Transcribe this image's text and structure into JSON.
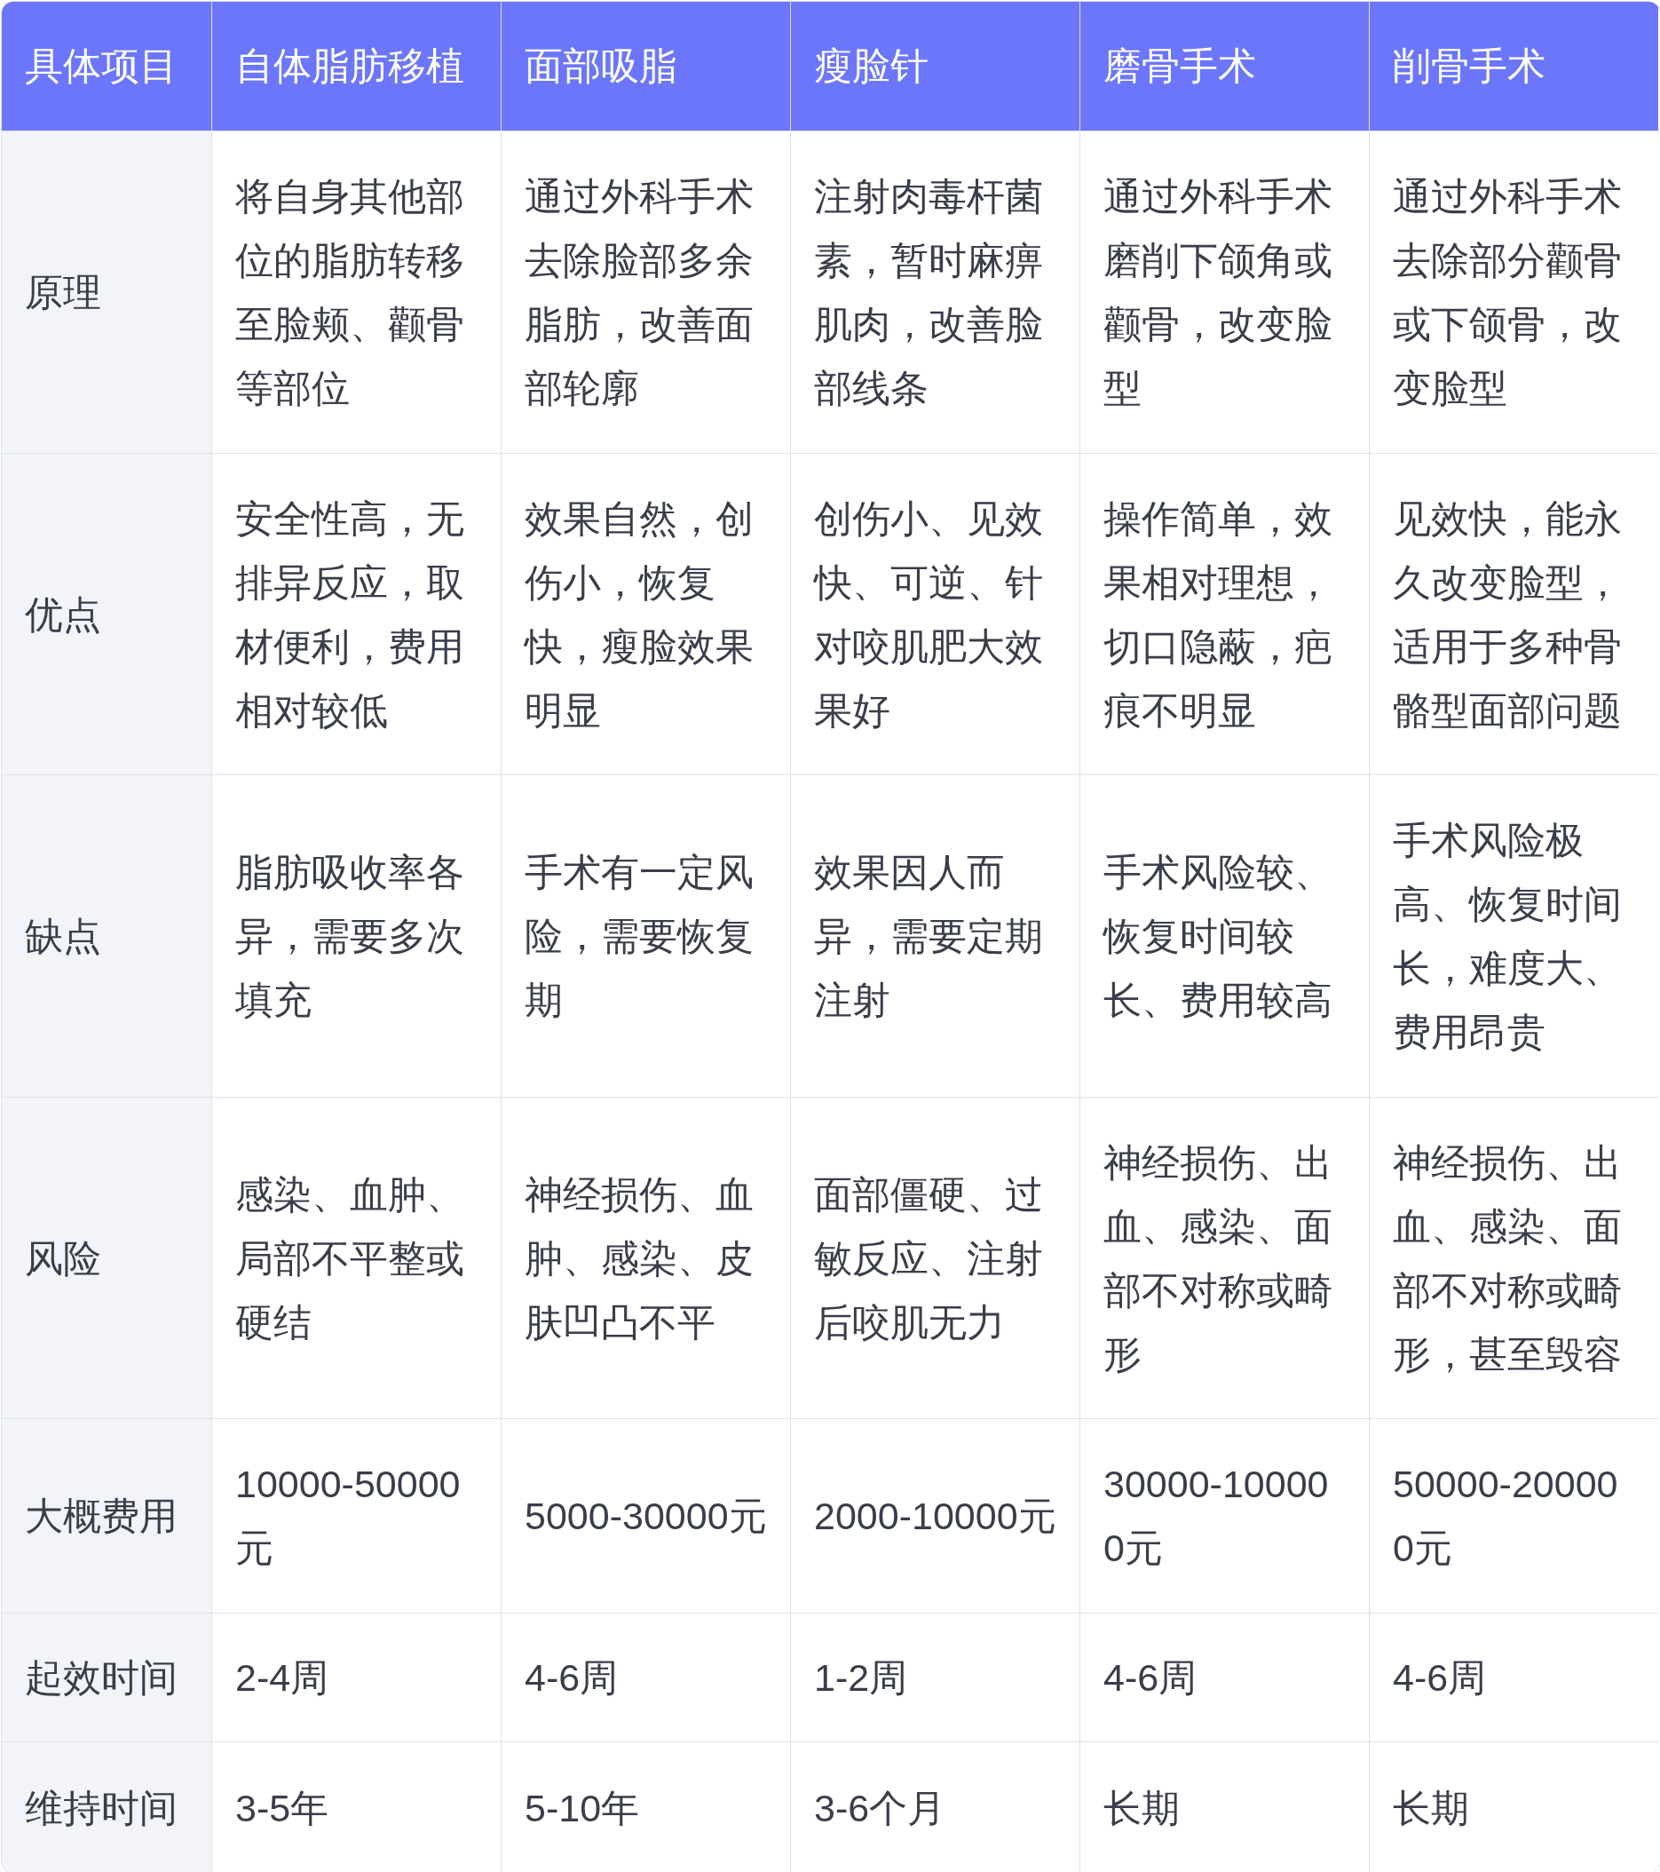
{
  "table": {
    "columns": [
      "具体项目",
      "自体脂肪移植",
      "面部吸脂",
      "瘦脸针",
      "磨骨手术",
      "削骨手术"
    ],
    "rows": [
      {
        "cells": [
          "原理",
          "将自身其他部位的脂肪转移至脸颊、颧骨等部位",
          "通过外科手术去除脸部多余脂肪，改善面部轮廓",
          "注射肉毒杆菌素，暂时麻痹肌肉，改善脸部线条",
          "通过外科手术磨削下颌角或颧骨，改变脸型",
          "通过外科手术去除部分颧骨或下颌骨，改变脸型"
        ]
      },
      {
        "cells": [
          "优点",
          "安全性高，无排异反应，取材便利，费用相对较低",
          "效果自然，创伤小，恢复快，瘦脸效果明显",
          "创伤小、见效快、可逆、针对咬肌肥大效果好",
          "操作简单，效果相对理想，切口隐蔽，疤痕不明显",
          "见效快，能永久改变脸型，适用于多种骨骼型面部问题"
        ]
      },
      {
        "cells": [
          "缺点",
          "脂肪吸收率各异，需要多次填充",
          "手术有一定风险，需要恢复期",
          "效果因人而异，需要定期注射",
          "手术风险较、恢复时间较长、费用较高",
          "手术风险极高、恢复时间长，难度大、费用昂贵"
        ]
      },
      {
        "cells": [
          "风险",
          "感染、血肿、局部不平整或硬结",
          "神经损伤、血肿、感染、皮肤凹凸不平",
          "面部僵硬、过敏反应、注射后咬肌无力",
          "神经损伤、出血、感染、面部不对称或畸形",
          "神经损伤、出血、感染、面部不对称或畸形，甚至毁容"
        ]
      },
      {
        "cells": [
          "大概费用",
          "10000-50000元",
          "5000-30000元",
          "2000-10000元",
          "30000-100000元",
          "50000-200000元"
        ]
      },
      {
        "cells": [
          "起效时间",
          "2-4周",
          "4-6周",
          "1-2周",
          "4-6周",
          "4-6周"
        ]
      },
      {
        "cells": [
          "维持时间",
          "3-5年",
          "5-10年",
          "3-6个月",
          "长期",
          "长期"
        ]
      }
    ]
  }
}
